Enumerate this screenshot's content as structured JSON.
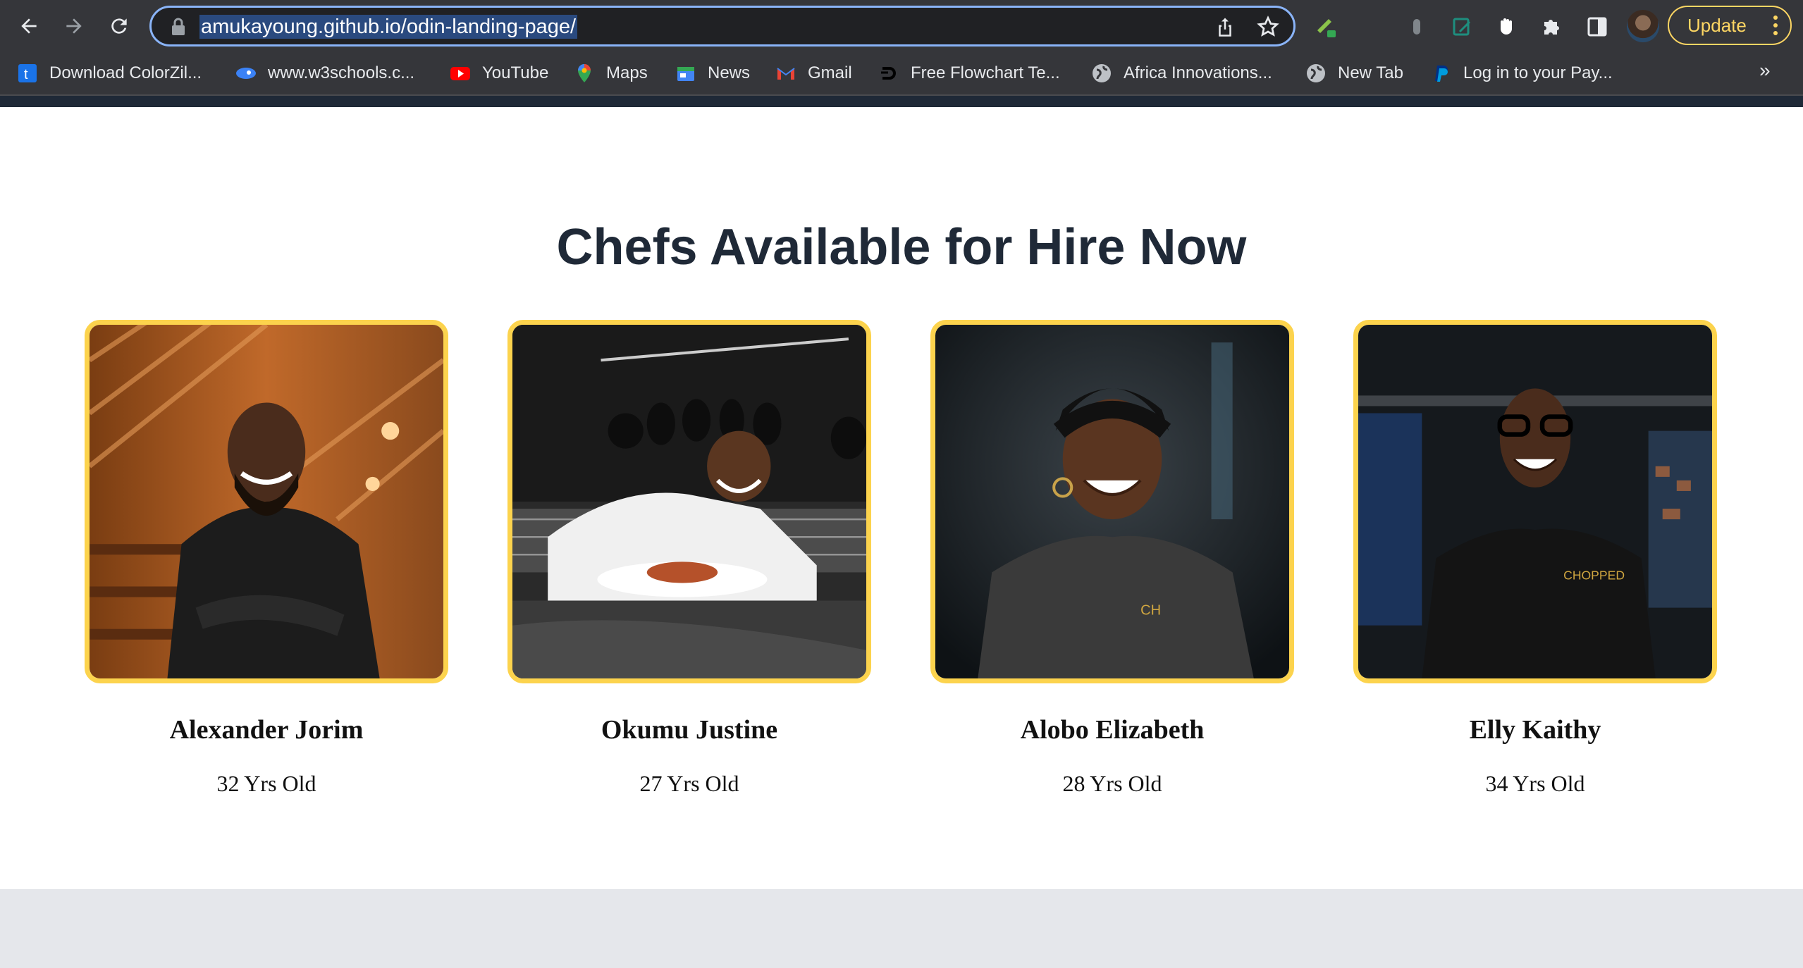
{
  "browser": {
    "url": "amukayoung.github.io/odin-landing-page/",
    "update_label": "Update",
    "bookmarks": [
      {
        "label": "Download ColorZil...",
        "icon": "colorzilla-icon"
      },
      {
        "label": "www.w3schools.c...",
        "icon": "w3schools-icon"
      },
      {
        "label": "YouTube",
        "icon": "youtube-icon"
      },
      {
        "label": "Maps",
        "icon": "maps-pin-icon"
      },
      {
        "label": "News",
        "icon": "news-icon"
      },
      {
        "label": "Gmail",
        "icon": "gmail-icon"
      },
      {
        "label": "Free Flowchart Te...",
        "icon": "flowchart-icon"
      },
      {
        "label": "Africa Innovations...",
        "icon": "globe-icon"
      },
      {
        "label": "New Tab",
        "icon": "globe-icon"
      },
      {
        "label": "Log in to your Pay...",
        "icon": "paypal-icon"
      }
    ],
    "more_bookmarks": "»"
  },
  "page": {
    "heading": "Chefs Available for Hire Now",
    "chefs": [
      {
        "name": "Alexander Jorim",
        "age": "32 Yrs Old"
      },
      {
        "name": "Okumu Justine",
        "age": "27 Yrs Old"
      },
      {
        "name": "Alobo Elizabeth",
        "age": "28 Yrs Old"
      },
      {
        "name": "Elly Kaithy",
        "age": "34 Yrs Old"
      }
    ]
  },
  "colors": {
    "accent_border": "#fcd34d",
    "heading": "#1f2937",
    "update_button": "#fdd663",
    "omnibox_focus": "#8ab4f8",
    "footer_band": "#e5e7eb"
  }
}
